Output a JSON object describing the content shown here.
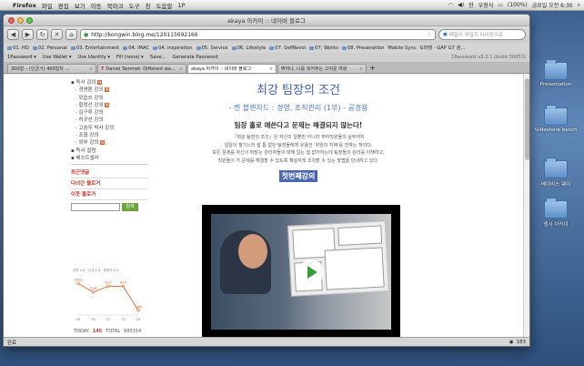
{
  "menubar": {
    "app": "Firefox",
    "items": [
      "파일",
      "편집",
      "보기",
      "이동",
      "북마크",
      "도구",
      "창",
      "도움말",
      "1P"
    ],
    "battery": "(100%)",
    "time": "금요일 오전 6:30",
    "user": "우형식",
    "lang": "한"
  },
  "window": {
    "title": "akaya 아카이 :: 네이버 블로그"
  },
  "navbar": {
    "url": "http://kongwin.blog.me/120115692166",
    "search_placeholder": "패밀리 여밀히 타이밍으로",
    "back": "◀",
    "forward": "▶"
  },
  "bookmarks": [
    "01. HQ",
    "02. Personal",
    "03. Entertainment",
    "04. iMAC",
    "04. Inspiration",
    "05. Service",
    "06. Lifestyle",
    "07. SelfRevol",
    "07. Works",
    "08. Presenation",
    "Mobile Sync",
    "G마켓 - GAP G7 검..."
  ],
  "addons": {
    "items": [
      "1Password ▾",
      "Use Wallet ▾",
      "Use Identity ▾",
      "Fill (none) ▾",
      "Save...",
      "Generate Password"
    ],
    "version": "1Password v3.2.1 (build 30053)"
  },
  "tabs": [
    {
      "label": "300일 – (인균기) 400일차 ..."
    },
    {
      "label": "Daniel Tammet: Different way..."
    },
    {
      "label": "akaya 아카이 :: 네이버 블로그"
    },
    {
      "label": "뛰어나, 나를 잊어주는 고이운 여왕"
    }
  ],
  "sidebar": {
    "categories": [
      {
        "label": "독서 감의",
        "badge": true,
        "indent": false
      },
      {
        "label": "경영론 강의",
        "badge": true,
        "indent": true
      },
      {
        "label": "모습쓰 강의",
        "badge": false,
        "indent": true
      },
      {
        "label": "황정선 강의",
        "badge": true,
        "indent": true
      },
      {
        "label": "김구루 강의",
        "badge": false,
        "indent": true
      },
      {
        "label": "허규선 강의",
        "badge": false,
        "indent": true
      },
      {
        "label": "고승우 박사 강의",
        "badge": false,
        "indent": true
      },
      {
        "label": "조형 강의",
        "badge": false,
        "indent": true
      },
      {
        "label": "외부 강의",
        "badge": true,
        "indent": true
      },
      {
        "label": "독서 컬럼",
        "badge": false,
        "indent": false
      },
      {
        "label": "베스트셀러",
        "badge": false,
        "indent": false
      }
    ],
    "section1": "최근댓글",
    "section2": "다녀간 블로거",
    "section3": "이웃 블로거",
    "search_btn": "검색",
    "chart_legend": "이웃 2.8 · 신규 1.6 · 방문자 0.2",
    "today_label": "TODAY",
    "today_value": "145",
    "total_label": "TOTAL",
    "total_value": "683314"
  },
  "post": {
    "title": "최강 팀장의 조건",
    "subtitle": "- 켄 블랜차드 : 경영, 조직관리 (1부) - 공경용",
    "headline": "팀장 홀로 애쓴다고 문제는 해결되지 않는다!",
    "body": [
      "『최강 팀장의 조건』은 자신의 일뿐만 아니라 부하직원들의 실무까지",
      "일일이 챙기느라 쉼 틈 없던 팀장들에게 유용한 '위임의 지혜'를 전하는 책이다.",
      "모든 문제를 자신이 떠맡는 관리자들이 대해 일는 쉼 없어하는데 팀장들의 원리를 이해하고,",
      "직원들이 가 문제를 해결할 수 있도록 확실하게 조치할 수 있는 방법을 안내하고 있다."
    ],
    "lecture_label": "첫번째강의"
  },
  "statusbar": {
    "left": "완료",
    "right": "183"
  },
  "desktop": [
    {
      "label": "Presentation"
    },
    {
      "label": "Slideshare bench"
    },
    {
      "label": "베이비스 웨이"
    },
    {
      "label": "생시 아카이"
    }
  ],
  "chart_data": {
    "type": "line",
    "categories": [
      "19",
      "20",
      "21",
      "22",
      "23"
    ],
    "values": [
      1002,
      726,
      917,
      907,
      148
    ],
    "title": "",
    "xlabel": "",
    "ylabel": ""
  }
}
